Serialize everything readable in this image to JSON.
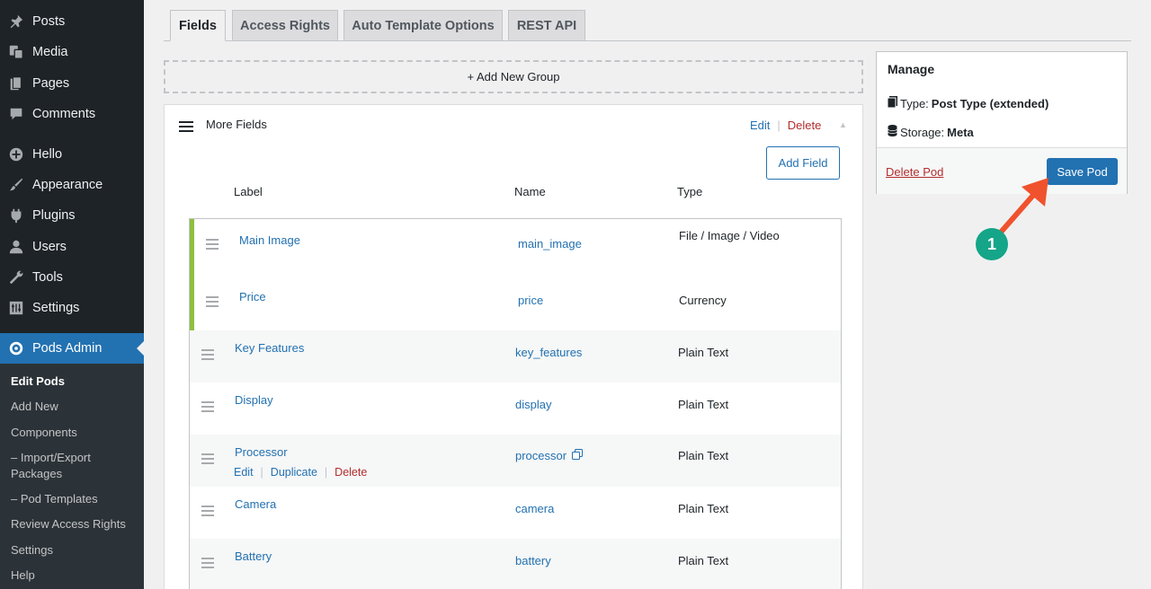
{
  "sidebar": {
    "items": [
      {
        "label": "Posts",
        "icon": "pin-icon"
      },
      {
        "label": "Media",
        "icon": "media-icon"
      },
      {
        "label": "Pages",
        "icon": "pages-icon"
      },
      {
        "label": "Comments",
        "icon": "comments-icon"
      },
      {
        "label": "Hello",
        "icon": "plus-circle-icon"
      },
      {
        "label": "Appearance",
        "icon": "brush-icon"
      },
      {
        "label": "Plugins",
        "icon": "plug-icon"
      },
      {
        "label": "Users",
        "icon": "user-icon"
      },
      {
        "label": "Tools",
        "icon": "wrench-icon"
      },
      {
        "label": "Settings",
        "icon": "settings-icon"
      },
      {
        "label": "Pods Admin",
        "icon": "pods-icon"
      }
    ],
    "submenu": [
      "Edit Pods",
      "Add New",
      "Components",
      "– Import/Export Packages",
      "– Pod Templates",
      "Review Access Rights",
      "Settings",
      "Help"
    ]
  },
  "tabs": [
    "Fields",
    "Access Rights",
    "Auto Template Options",
    "REST API"
  ],
  "add_group_label": "+ Add New Group",
  "group": {
    "title": "More Fields",
    "edit": "Edit",
    "delete": "Delete",
    "add_field": "Add Field",
    "columns": {
      "label": "Label",
      "name": "Name",
      "type": "Type"
    },
    "fields": [
      {
        "label": "Main Image",
        "name": "main_image",
        "type": "File / Image / Video"
      },
      {
        "label": "Price",
        "name": "price",
        "type": "Currency"
      },
      {
        "label": "Key Features",
        "name": "key_features",
        "type": "Plain Text"
      },
      {
        "label": "Display",
        "name": "display",
        "type": "Plain Text"
      },
      {
        "label": "Processor",
        "name": "processor",
        "type": "Plain Text"
      },
      {
        "label": "Camera",
        "name": "camera",
        "type": "Plain Text"
      },
      {
        "label": "Battery",
        "name": "battery",
        "type": "Plain Text"
      }
    ],
    "row_actions": {
      "edit": "Edit",
      "duplicate": "Duplicate",
      "delete": "Delete"
    }
  },
  "manage": {
    "title": "Manage",
    "type_label": "Type:",
    "type_value": "Post Type (extended)",
    "storage_label": "Storage:",
    "storage_value": "Meta",
    "delete_pod": "Delete Pod",
    "save_pod": "Save Pod"
  },
  "callout": "1",
  "colors": {
    "accent": "#2271b1",
    "danger": "#b32d2e",
    "highlight": "#8ec03f",
    "arrow": "#f0522d",
    "callout": "#15a589"
  }
}
